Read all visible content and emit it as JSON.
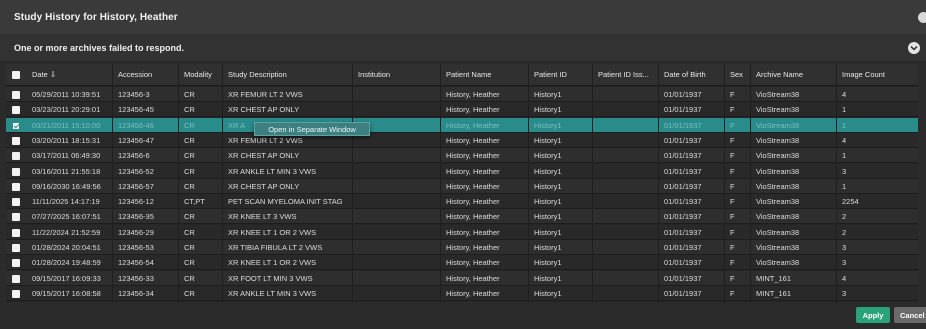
{
  "window": {
    "title": "Study History for History, Heather",
    "warning": "One or more archives failed to respond."
  },
  "colors": {
    "selected_row": "#2a8b8b",
    "apply_button": "#2aa37a",
    "cancel_button": "#6a6a6a"
  },
  "table": {
    "columns": [
      {
        "key": "date",
        "label": "Date ⇩"
      },
      {
        "key": "accession",
        "label": "Accession"
      },
      {
        "key": "modality",
        "label": "Modality"
      },
      {
        "key": "description",
        "label": "Study Description"
      },
      {
        "key": "institution",
        "label": "Institution"
      },
      {
        "key": "patient_name",
        "label": "Patient Name"
      },
      {
        "key": "patient_id",
        "label": "Patient ID"
      },
      {
        "key": "patient_id_iss",
        "label": "Patient ID Iss..."
      },
      {
        "key": "dob",
        "label": "Date of Birth"
      },
      {
        "key": "sex",
        "label": "Sex"
      },
      {
        "key": "archive",
        "label": "Archive Name"
      },
      {
        "key": "image_count",
        "label": "Image Count"
      }
    ],
    "rows": [
      {
        "checked": false,
        "selected": false,
        "date": "05/29/2011 10:39:51",
        "accession": "123456-3",
        "modality": "CR",
        "description": "XR FEMUR LT 2 VWS",
        "institution": "",
        "patient_name": "History, Heather",
        "patient_id": "History1",
        "patient_id_iss": "",
        "dob": "01/01/1937",
        "sex": "F",
        "archive": "VioStream38",
        "image_count": "4"
      },
      {
        "checked": false,
        "selected": false,
        "date": "03/23/2011 20:29:01",
        "accession": "123456-45",
        "modality": "CR",
        "description": "XR CHEST AP ONLY",
        "institution": "",
        "patient_name": "History, Heather",
        "patient_id": "History1",
        "patient_id_iss": "",
        "dob": "01/01/1937",
        "sex": "F",
        "archive": "VioStream38",
        "image_count": "1"
      },
      {
        "checked": true,
        "selected": true,
        "date": "03/21/2011 15:10:00",
        "accession": "123456-46",
        "modality": "CR",
        "description": "XR A",
        "institution": "",
        "patient_name": "History, Heather",
        "patient_id": "History1",
        "patient_id_iss": "",
        "dob": "01/01/1937",
        "sex": "F",
        "archive": "VioStream38",
        "image_count": "1"
      },
      {
        "checked": false,
        "selected": false,
        "date": "03/20/2011 18:15:31",
        "accession": "123456-47",
        "modality": "CR",
        "description": "XR FEMUR LT 2 VWS",
        "institution": "",
        "patient_name": "History, Heather",
        "patient_id": "History1",
        "patient_id_iss": "",
        "dob": "01/01/1937",
        "sex": "F",
        "archive": "VioStream38",
        "image_count": "4"
      },
      {
        "checked": false,
        "selected": false,
        "date": "03/17/2011 06:49:30",
        "accession": "123456-6",
        "modality": "CR",
        "description": "XR CHEST AP ONLY",
        "institution": "",
        "patient_name": "History, Heather",
        "patient_id": "History1",
        "patient_id_iss": "",
        "dob": "01/01/1937",
        "sex": "F",
        "archive": "VioStream38",
        "image_count": "1"
      },
      {
        "checked": false,
        "selected": false,
        "date": "03/16/2011 21:55:18",
        "accession": "123456-52",
        "modality": "CR",
        "description": "XR ANKLE LT MIN 3 VWS",
        "institution": "",
        "patient_name": "History, Heather",
        "patient_id": "History1",
        "patient_id_iss": "",
        "dob": "01/01/1937",
        "sex": "F",
        "archive": "VioStream38",
        "image_count": "3"
      },
      {
        "checked": false,
        "selected": false,
        "date": "09/16/2030 16:49:56",
        "accession": "123456-57",
        "modality": "CR",
        "description": "XR CHEST AP ONLY",
        "institution": "",
        "patient_name": "History, Heather",
        "patient_id": "History1",
        "patient_id_iss": "",
        "dob": "01/01/1937",
        "sex": "F",
        "archive": "VioStream38",
        "image_count": "1"
      },
      {
        "checked": false,
        "selected": false,
        "date": "11/11/2025 14:17:19",
        "accession": "123456-12",
        "modality": "CT,PT",
        "description": "PET SCAN MYELOMA INIT STAG",
        "institution": "",
        "patient_name": "History, Heather",
        "patient_id": "History1",
        "patient_id_iss": "",
        "dob": "01/01/1937",
        "sex": "F",
        "archive": "VioStream38",
        "image_count": "2254"
      },
      {
        "checked": false,
        "selected": false,
        "date": "07/27/2025 16:07:51",
        "accession": "123456-35",
        "modality": "CR",
        "description": "XR KNEE LT 3 VWS",
        "institution": "",
        "patient_name": "History, Heather",
        "patient_id": "History1",
        "patient_id_iss": "",
        "dob": "01/01/1937",
        "sex": "F",
        "archive": "VioStream38",
        "image_count": "2"
      },
      {
        "checked": false,
        "selected": false,
        "date": "11/22/2024 21:52:59",
        "accession": "123456-29",
        "modality": "CR",
        "description": "XR KNEE LT 1 OR 2 VWS",
        "institution": "",
        "patient_name": "History, Heather",
        "patient_id": "History1",
        "patient_id_iss": "",
        "dob": "01/01/1937",
        "sex": "F",
        "archive": "VioStream38",
        "image_count": "2"
      },
      {
        "checked": false,
        "selected": false,
        "date": "01/28/2024 20:04:51",
        "accession": "123456-53",
        "modality": "CR",
        "description": "XR TIBIA FIBULA LT 2 VWS",
        "institution": "",
        "patient_name": "History, Heather",
        "patient_id": "History1",
        "patient_id_iss": "",
        "dob": "01/01/1937",
        "sex": "F",
        "archive": "VioStream38",
        "image_count": "3"
      },
      {
        "checked": false,
        "selected": false,
        "date": "01/28/2024 19:48:59",
        "accession": "123456-54",
        "modality": "CR",
        "description": "XR KNEE LT 1 OR 2 VWS",
        "institution": "",
        "patient_name": "History, Heather",
        "patient_id": "History1",
        "patient_id_iss": "",
        "dob": "01/01/1937",
        "sex": "F",
        "archive": "VioStream38",
        "image_count": "3"
      },
      {
        "checked": false,
        "selected": false,
        "date": "09/15/2017 16:09:33",
        "accession": "123456-33",
        "modality": "CR",
        "description": "XR FOOT LT MIN 3 VWS",
        "institution": "",
        "patient_name": "History, Heather",
        "patient_id": "History1",
        "patient_id_iss": "",
        "dob": "01/01/1937",
        "sex": "F",
        "archive": "MINT_161",
        "image_count": "4"
      },
      {
        "checked": false,
        "selected": false,
        "date": "09/15/2017 16:08:58",
        "accession": "123456-34",
        "modality": "CR",
        "description": "XR ANKLE LT MIN 3 VWS",
        "institution": "",
        "patient_name": "History, Heather",
        "patient_id": "History1",
        "patient_id_iss": "",
        "dob": "01/01/1937",
        "sex": "F",
        "archive": "MINT_161",
        "image_count": "3"
      }
    ]
  },
  "context_menu": {
    "item": "Open in Separate Window"
  },
  "footer": {
    "apply_label": "Apply",
    "cancel_label": "Cancel"
  }
}
